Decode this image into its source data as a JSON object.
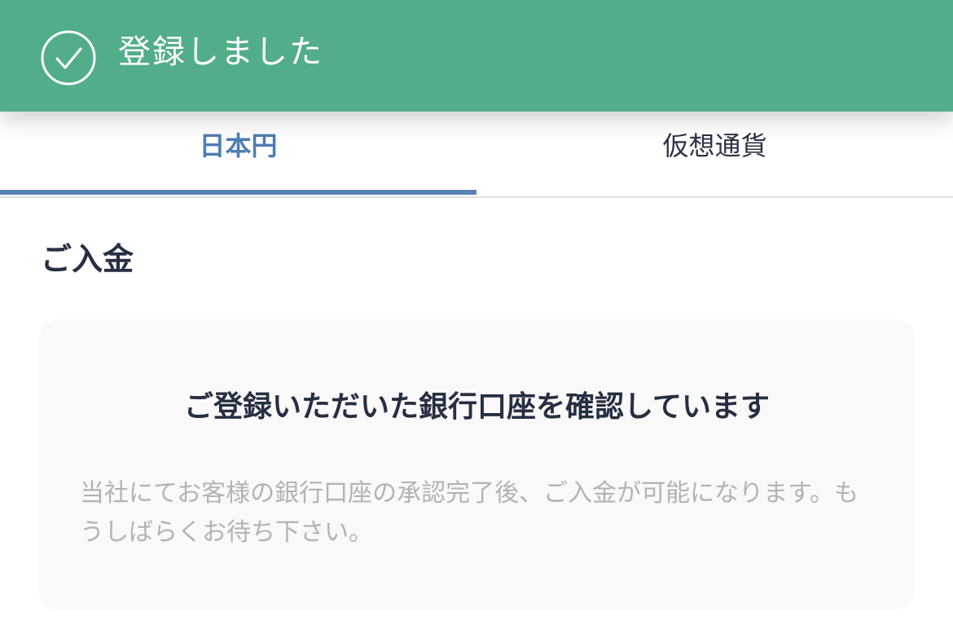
{
  "toast": {
    "icon": "check-circle-icon",
    "message": "登録しました",
    "color": "#52ae88"
  },
  "tabs": {
    "items": [
      {
        "label": "日本円",
        "active": true
      },
      {
        "label": "仮想通貨",
        "active": false
      }
    ],
    "active_color": "#4f7db4"
  },
  "section": {
    "title": "ご入金"
  },
  "notice": {
    "title": "ご登録いただいた銀行口座を確認しています",
    "body": "当社にてお客様の銀行口座の承認完了後、ご入金が可能になります。もうしばらくお待ち下さい。"
  }
}
